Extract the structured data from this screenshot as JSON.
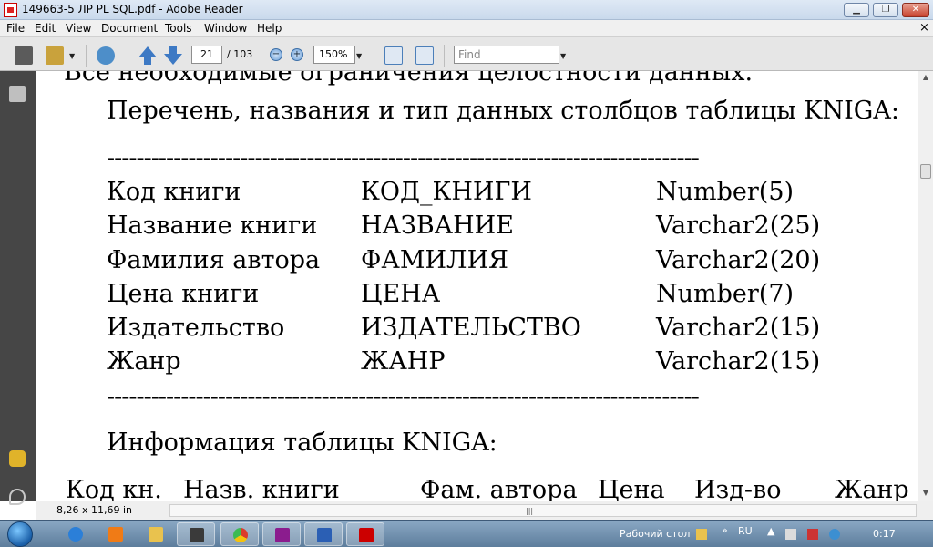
{
  "window": {
    "title": "149663-5 ЛР PL SQL.pdf - Adobe Reader",
    "min_glyph": "▁",
    "max_glyph": "❐",
    "close_glyph": "✕"
  },
  "menu": {
    "items": [
      "File",
      "Edit",
      "View",
      "Document",
      "Tools",
      "Window",
      "Help"
    ],
    "doc_close": "×"
  },
  "toolbar": {
    "current_page": "21",
    "page_total": "/ 103",
    "zoom": "150%",
    "find_placeholder": "Find",
    "zoom_out_glyph": "−",
    "zoom_in_glyph": "+"
  },
  "document": {
    "cut_line": "Все необходимые ограничения целостности данных.",
    "heading1": "Перечень, названия и тип данных столбцов таблицы KNIGA:",
    "separator": "--------------------------------------------------------------------------------",
    "columns_table": [
      [
        "Код книги",
        "КОД_КНИГИ",
        "Number(5)"
      ],
      [
        "Название книги",
        "НАЗВАНИЕ",
        "Varchar2(25)"
      ],
      [
        "Фамилия автора",
        "ФАМИЛИЯ",
        "Varchar2(20)"
      ],
      [
        "Цена книги",
        "ЦЕНА",
        "Number(7)"
      ],
      [
        "Издательство",
        "ИЗДАТЕЛЬСТВО",
        "Varchar2(15)"
      ],
      [
        "Жанр",
        "ЖАНР",
        "Varchar2(15)"
      ]
    ],
    "heading2": "Информация таблицы KNIGA:",
    "info_headers": [
      "Код кн.",
      "Назв. книги",
      "Фам. автора",
      "Цена",
      "Изд-во",
      "Жанр"
    ]
  },
  "status": {
    "page_size": "8,26 x 11,69 in"
  },
  "taskbar": {
    "desktop_label": "Рабочий стол",
    "language": "RU",
    "clock": "0:17",
    "chevron": "»"
  },
  "colors": {
    "nav_panel": "#464646",
    "taskbar": "#6f8fae",
    "acrobat_red": "#cc0000"
  },
  "icons": {
    "print": "printer-icon",
    "attach": "paperclip-icon",
    "comments": "comments-icon",
    "pages": "pages-icon"
  }
}
